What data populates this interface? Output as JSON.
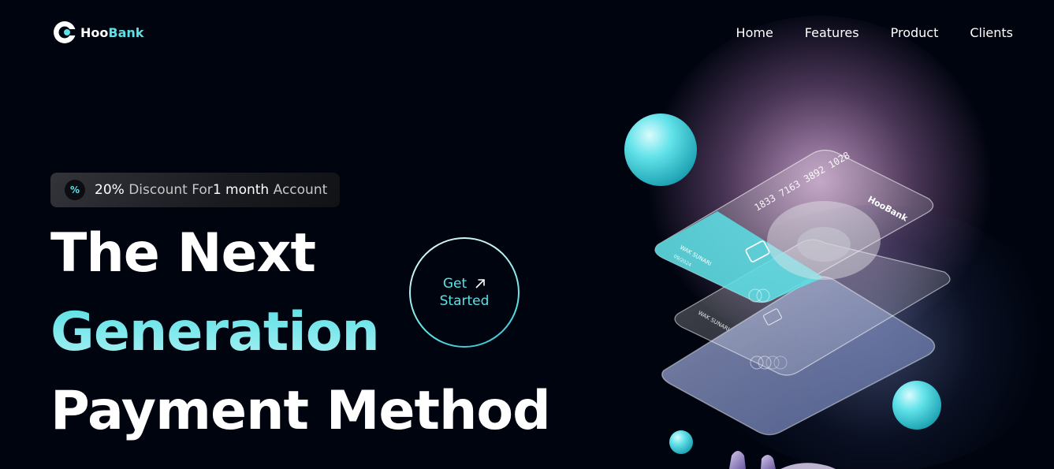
{
  "brand": {
    "name_part1": "Hoo",
    "name_part2": "Bank"
  },
  "nav": {
    "items": [
      "Home",
      "Features",
      "Product",
      "Clients"
    ]
  },
  "badge": {
    "icon_text": "%",
    "pct": "20%",
    "text1": " Discount For",
    "months": "1 month",
    "text2": " Account"
  },
  "hero": {
    "line1": "The Next",
    "line2": "Generation",
    "line3": "Payment Method",
    "cta_line1": "Get",
    "cta_line2": "Started"
  },
  "card_art": {
    "card_number": "1833 7163 3892 1028",
    "brand_label": "HooBank",
    "holder": "WAK SUNARI",
    "holder_expiry": "09/2024"
  },
  "colors": {
    "accent": "#5ce1e6",
    "background": "#00040f"
  }
}
